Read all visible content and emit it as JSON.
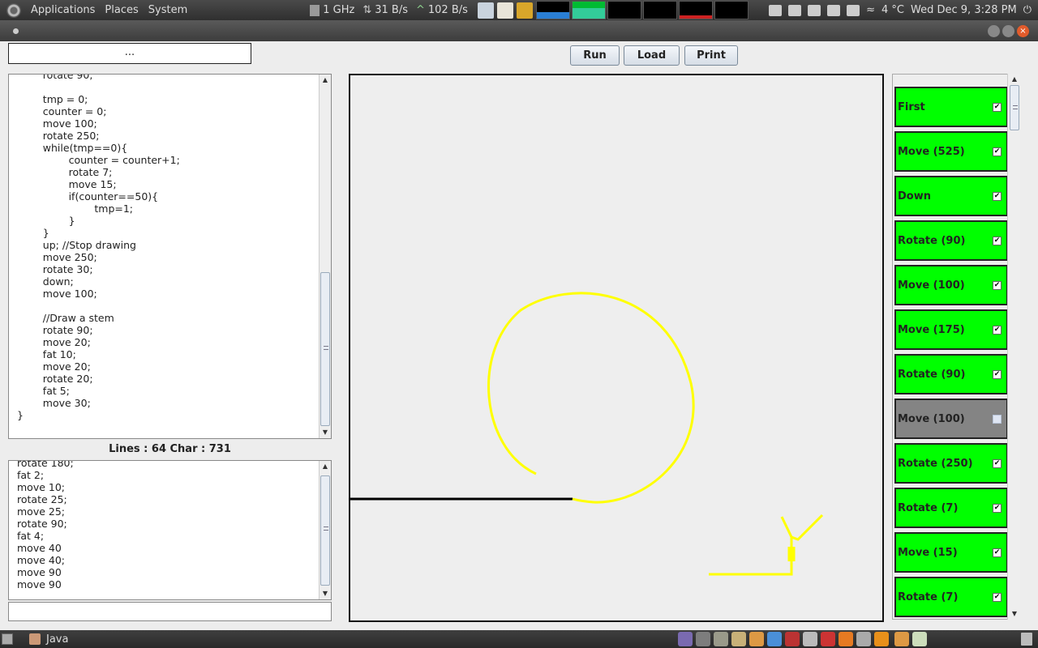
{
  "top_panel": {
    "menus": [
      "Applications",
      "Places",
      "System"
    ],
    "cpu": "1 GHz",
    "down_rate": "31 B/s",
    "up_rate": "102 B/s",
    "temperature": "4 °C",
    "datetime": "Wed Dec  9,  3:28 PM"
  },
  "toolbar": {
    "file_field": "...",
    "run_label": "Run",
    "load_label": "Load",
    "print_label": "Print"
  },
  "editor": {
    "text": "        rotate 90;\n\n        tmp = 0;\n        counter = 0;\n        move 100;\n        rotate 250;\n        while(tmp==0){\n                counter = counter+1;\n                rotate 7;\n                move 15;\n                if(counter==50){\n                        tmp=1;\n                }\n        }\n        up; //Stop drawing\n        move 250;\n        rotate 30;\n        down;\n        move 100;\n\n        //Draw a stem\n        rotate 90;\n        move 20;\n        fat 10;\n        move 20;\n        rotate 20;\n        fat 5;\n        move 30;\n}"
  },
  "stats": {
    "text": "Lines :  64 Char :  731"
  },
  "console": {
    "text": "rotate 180;\nfat 2;\nmove 10;\nrotate 25;\nmove 25;\nrotate 90;\nfat 4;\nmove 40\nmove 40;\nmove 90\nmove 90"
  },
  "command_list": [
    {
      "label": "First",
      "checked": true
    },
    {
      "label": "Move (525)",
      "checked": true
    },
    {
      "label": "Down",
      "checked": true
    },
    {
      "label": "Rotate (90)",
      "checked": true
    },
    {
      "label": "Move (100)",
      "checked": true
    },
    {
      "label": "Move (175)",
      "checked": true
    },
    {
      "label": "Rotate (90)",
      "checked": true
    },
    {
      "label": "Move (100)",
      "checked": false
    },
    {
      "label": "Rotate (250)",
      "checked": true
    },
    {
      "label": "Rotate (7)",
      "checked": true
    },
    {
      "label": "Move (15)",
      "checked": true
    },
    {
      "label": "Rotate (7)",
      "checked": true
    }
  ],
  "taskbar": {
    "active_task": "Java"
  },
  "colors": {
    "enabled_item": "#00ff00",
    "disabled_item": "#848484",
    "drawing_stroke": "#ffff00",
    "drawing_line": "#000000"
  }
}
